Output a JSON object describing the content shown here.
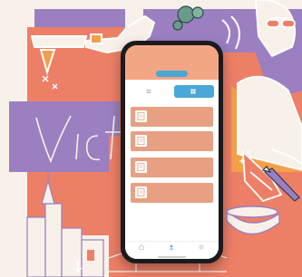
{
  "background": {
    "scene": "illustrated-poster",
    "colors": {
      "coral": "#ee7f67",
      "purple": "#9b7fc1",
      "orange": "#f4a04a",
      "cream": "#f8f1e9",
      "line": "#ffffff"
    }
  },
  "phone": {
    "app": {
      "status_time": "",
      "status_icons": "",
      "title": "",
      "tab_label": "",
      "toggle": {
        "left_label": "",
        "right_label": ""
      },
      "cards": [
        {
          "title": "",
          "subtitle": "",
          "icon": "document-icon"
        },
        {
          "title": "",
          "subtitle": "",
          "icon": "document-icon"
        },
        {
          "title": "",
          "subtitle": "",
          "icon": "document-icon"
        },
        {
          "title": "",
          "subtitle": "",
          "icon": "document-icon"
        }
      ],
      "nav": [
        {
          "label": "",
          "icon": "home-icon"
        },
        {
          "label": "",
          "icon": "user-icon"
        },
        {
          "label": "",
          "icon": "settings-icon"
        }
      ],
      "colors": {
        "header": "#f3a684",
        "accent": "#4ba7d6",
        "card": "#e8a082"
      }
    }
  }
}
